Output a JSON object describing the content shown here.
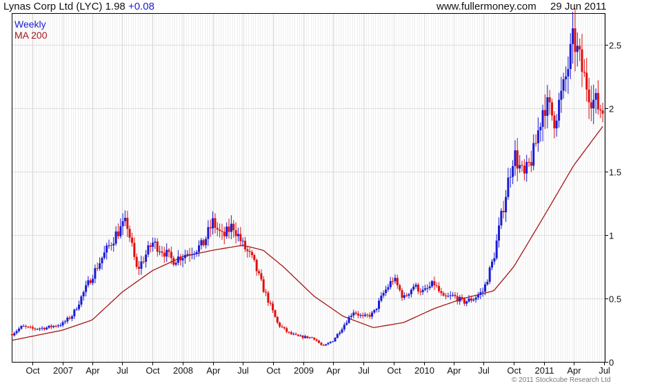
{
  "header": {
    "symbol": "Lynas Corp Ltd (LYC)",
    "price": "1.98",
    "change": "+0.08",
    "site": "www.fullermoney.com",
    "date": "29 Jun 2011"
  },
  "legend": {
    "period": "Weekly",
    "ma": "MA 200"
  },
  "copyright": "© 2011 Stockcube Research Ltd",
  "colors": {
    "up": "#1b1bd6",
    "down": "#e01010",
    "ma": "#a31515",
    "grid": "#dcdcdc",
    "axis": "#000000"
  },
  "chart_data": {
    "type": "candlestick",
    "ylim": [
      0,
      2.75
    ],
    "yticks": [
      0,
      0.5,
      1,
      1.5,
      2,
      2.5
    ],
    "ytick_labels": [
      "0",
      "0.5",
      "1",
      "1.5",
      "2",
      "2.5"
    ],
    "xlim": [
      "2006-07-31",
      "2011-07-04"
    ],
    "xticks": [
      {
        "date": "2006-10-01",
        "label": "Oct"
      },
      {
        "date": "2007-01-01",
        "label": "2007"
      },
      {
        "date": "2007-04-01",
        "label": "Apr"
      },
      {
        "date": "2007-07-01",
        "label": "Jul"
      },
      {
        "date": "2007-10-01",
        "label": "Oct"
      },
      {
        "date": "2008-01-01",
        "label": "2008"
      },
      {
        "date": "2008-04-01",
        "label": "Apr"
      },
      {
        "date": "2008-07-01",
        "label": "Jul"
      },
      {
        "date": "2008-10-01",
        "label": "Oct"
      },
      {
        "date": "2009-01-01",
        "label": "2009"
      },
      {
        "date": "2009-04-01",
        "label": "Apr"
      },
      {
        "date": "2009-07-01",
        "label": "Jul"
      },
      {
        "date": "2009-10-01",
        "label": "Oct"
      },
      {
        "date": "2010-01-01",
        "label": "2010"
      },
      {
        "date": "2010-04-01",
        "label": "Apr"
      },
      {
        "date": "2010-07-01",
        "label": "Jul"
      },
      {
        "date": "2010-10-01",
        "label": "Oct"
      },
      {
        "date": "2011-01-01",
        "label": "2011"
      },
      {
        "date": "2011-04-01",
        "label": "Apr"
      },
      {
        "date": "2011-07-01",
        "label": "Jul"
      }
    ],
    "grid": true,
    "close_anchors": [
      [
        "2006-08-01",
        0.22
      ],
      [
        "2006-09-01",
        0.28
      ],
      [
        "2006-10-01",
        0.26
      ],
      [
        "2006-11-15",
        0.27
      ],
      [
        "2007-01-01",
        0.3
      ],
      [
        "2007-02-01",
        0.37
      ],
      [
        "2007-03-01",
        0.52
      ],
      [
        "2007-04-01",
        0.68
      ],
      [
        "2007-05-01",
        0.82
      ],
      [
        "2007-06-15",
        1.02
      ],
      [
        "2007-07-15",
        1.1
      ],
      [
        "2007-08-15",
        0.72
      ],
      [
        "2007-10-01",
        0.94
      ],
      [
        "2007-11-01",
        0.88
      ],
      [
        "2007-12-01",
        0.8
      ],
      [
        "2008-01-01",
        0.84
      ],
      [
        "2008-03-01",
        0.92
      ],
      [
        "2008-04-01",
        1.1
      ],
      [
        "2008-05-01",
        0.98
      ],
      [
        "2008-06-01",
        1.08
      ],
      [
        "2008-07-01",
        0.92
      ],
      [
        "2008-08-01",
        0.8
      ],
      [
        "2008-09-01",
        0.58
      ],
      [
        "2008-10-15",
        0.3
      ],
      [
        "2008-11-15",
        0.23
      ],
      [
        "2008-12-15",
        0.2
      ],
      [
        "2009-02-01",
        0.19
      ],
      [
        "2009-03-01",
        0.12
      ],
      [
        "2009-04-01",
        0.17
      ],
      [
        "2009-05-01",
        0.28
      ],
      [
        "2009-06-01",
        0.4
      ],
      [
        "2009-07-01",
        0.35
      ],
      [
        "2009-08-01",
        0.38
      ],
      [
        "2009-09-01",
        0.54
      ],
      [
        "2009-10-01",
        0.66
      ],
      [
        "2009-11-01",
        0.5
      ],
      [
        "2009-12-01",
        0.6
      ],
      [
        "2010-01-01",
        0.55
      ],
      [
        "2010-02-01",
        0.62
      ],
      [
        "2010-03-01",
        0.5
      ],
      [
        "2010-04-01",
        0.52
      ],
      [
        "2010-05-01",
        0.47
      ],
      [
        "2010-06-01",
        0.5
      ],
      [
        "2010-07-01",
        0.56
      ],
      [
        "2010-08-01",
        0.82
      ],
      [
        "2010-09-01",
        1.25
      ],
      [
        "2010-10-01",
        1.65
      ],
      [
        "2010-11-01",
        1.45
      ],
      [
        "2010-12-01",
        1.65
      ],
      [
        "2011-01-01",
        2.05
      ],
      [
        "2011-02-01",
        1.92
      ],
      [
        "2011-03-01",
        2.15
      ],
      [
        "2011-04-01",
        2.55
      ],
      [
        "2011-05-01",
        2.25
      ],
      [
        "2011-06-01",
        2.05
      ],
      [
        "2011-06-29",
        1.98
      ]
    ],
    "ma200_anchors": [
      [
        "2006-08-01",
        0.17
      ],
      [
        "2007-01-01",
        0.25
      ],
      [
        "2007-04-01",
        0.33
      ],
      [
        "2007-07-01",
        0.55
      ],
      [
        "2007-10-01",
        0.72
      ],
      [
        "2008-01-01",
        0.83
      ],
      [
        "2008-04-01",
        0.88
      ],
      [
        "2008-07-01",
        0.92
      ],
      [
        "2008-09-01",
        0.88
      ],
      [
        "2008-11-01",
        0.75
      ],
      [
        "2009-02-01",
        0.52
      ],
      [
        "2009-05-01",
        0.36
      ],
      [
        "2009-08-01",
        0.27
      ],
      [
        "2009-11-01",
        0.31
      ],
      [
        "2010-02-01",
        0.42
      ],
      [
        "2010-05-01",
        0.5
      ],
      [
        "2010-08-01",
        0.56
      ],
      [
        "2010-10-01",
        0.75
      ],
      [
        "2011-01-01",
        1.15
      ],
      [
        "2011-04-01",
        1.55
      ],
      [
        "2011-06-29",
        1.86
      ]
    ]
  }
}
